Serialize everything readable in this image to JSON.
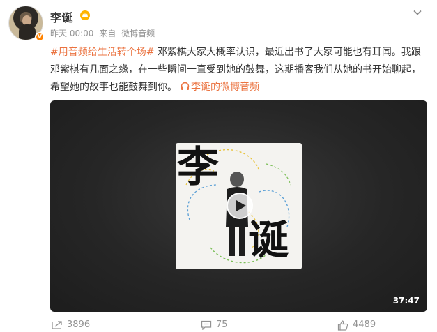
{
  "post": {
    "author": "李诞",
    "time": "昨天 00:00",
    "source_prefix": "来自",
    "source": "微博音频",
    "topic": "#用音频给生活转个场#",
    "body_text": " 邓紫棋大家大概率认识，最近出书了大家可能也有耳闻。我跟邓紫棋有几面之缘，在一些瞬间一直受到她的鼓舞，这期播客我们从她的书开始聊起，希望她的故事也能鼓舞到你。",
    "audio_link": "李诞的微博音频"
  },
  "video": {
    "cover_title_1": "李",
    "cover_title_2": "诞",
    "duration": "37:47"
  },
  "actions": {
    "repost_count": "3896",
    "comment_count": "75",
    "like_count": "4489"
  },
  "colors": {
    "accent": "#eb7340",
    "meta_gray": "#939393",
    "text": "#333333",
    "vip_orange": "#ff8200"
  },
  "icons": [
    "vip-crown-icon",
    "more-chevron-icon",
    "headphone-icon",
    "play-icon",
    "repost-icon",
    "comment-icon",
    "like-icon",
    "verified-badge-icon"
  ]
}
